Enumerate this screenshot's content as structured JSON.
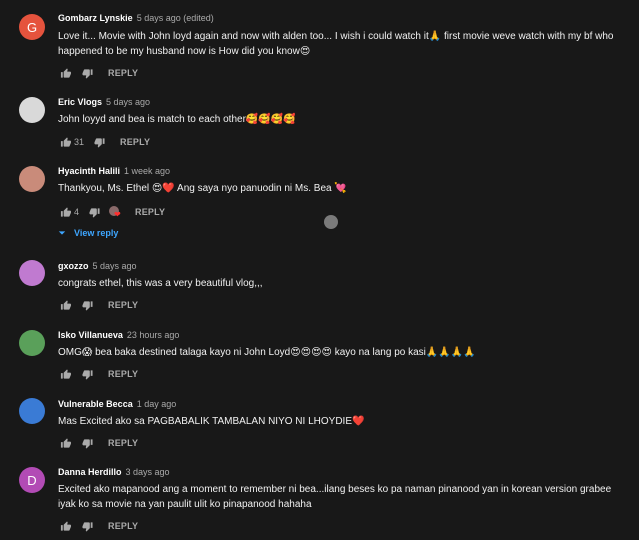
{
  "reply_label": "REPLY",
  "view_reply_label": "View reply",
  "comments": [
    {
      "author": "Gombarz Lynskie",
      "time": "5 days ago (edited)",
      "avatar_letter": "G",
      "avatar_color": "#e5533d",
      "text": "Love it... Movie with John loyd again and now with alden too... I wish i could watch it🙏 first movie weve watch with my  bf who happened to be my  husband  now is How did you know😍",
      "likes": ""
    },
    {
      "author": "Eric Vlogs",
      "time": "5 days ago",
      "avatar_color": "#d9d9d9",
      "text": "John loyyd and bea is match to each other🥰🥰🥰🥰",
      "likes": "31"
    },
    {
      "author": "Hyacinth Halili",
      "time": "1 week ago",
      "avatar_color": "#c98b7a",
      "text": "Thankyou, Ms. Ethel 😍❤️  Ang saya nyo panuodin ni Ms. Bea 💘",
      "likes": "4"
    },
    {
      "author": "gxozzo",
      "time": "5 days ago",
      "avatar_color": "#c07ad0",
      "text": "congrats ethel, this was a very beautiful  vlog,,,",
      "likes": ""
    },
    {
      "author": "Isko Villanueva",
      "time": "23 hours ago",
      "avatar_color": "#5aa05a",
      "text": "OMG😱 bea baka destined talaga kayo ni John Loyd😍😍😍😍 kayo na lang po kasi🙏🙏🙏🙏",
      "likes": ""
    },
    {
      "author": "Vulnerable Becca",
      "time": "1 day ago",
      "avatar_color": "#3a7bd5",
      "text": "Mas Excited ako sa PAGBABALIK TAMBALAN NIYO NI LHOYDIE❤️",
      "likes": ""
    },
    {
      "author": "Danna Herdillo",
      "time": "3 days ago",
      "avatar_letter": "D",
      "avatar_color": "#b24bb5",
      "text": "Excited ako mapanood ang a moment to remember ni bea...ilang beses ko pa naman pinanood yan in korean version grabee iyak ko sa movie na yan paulit ulit ko pinapanood hahaha",
      "likes": ""
    }
  ]
}
